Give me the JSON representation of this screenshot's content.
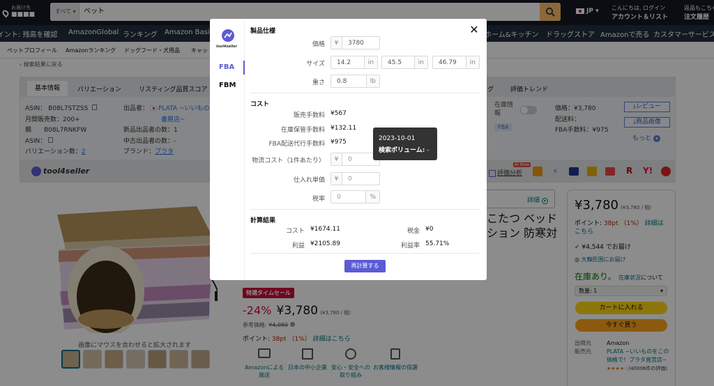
{
  "header": {
    "location_line1": "お届け先",
    "location_line2": "■■■■",
    "search_category": "すべて",
    "search_query": "ペット",
    "lang": "JP",
    "account_line1": "こんにちは, ログイン",
    "account_line2": "アカウント＆リスト",
    "orders_line1": "返品もこちら",
    "orders_line2": "注文履歴"
  },
  "nav": {
    "items": [
      "イント: 残高を確認",
      "AmazonGlobal",
      "ランキング",
      "Amazon Basics",
      "ホーム&キッチン",
      "ドラッグストア",
      "Amazonで売る",
      "カスタマーサービス"
    ]
  },
  "subnav": {
    "items": [
      "ペットプロフィール",
      "Amazonランキング",
      "ドッグフード・犬用品",
      "キャッ"
    ]
  },
  "breadcrumb": "‹ 検索結果に戻る",
  "ext_panel": {
    "tabs": [
      "基本情報",
      "バリエーション",
      "リスティング品質スコア",
      "グ",
      "評価トレンド"
    ],
    "asin_label": "ASIN：",
    "asin": "B08L7STZSS",
    "monthly_sales_label": "月間販売数：",
    "monthly_sales": "200+",
    "parent_label": "親",
    "parent_asin": "B08L7RNKFW",
    "asin2_label": "ASIN：",
    "variation_label": "バリエーション数：",
    "variation_count": "2",
    "seller_label": "出品者：",
    "seller": "PLATA ~いいもの",
    "seller2": "書屋店~",
    "new_sellers_label": "新品出品者の数：",
    "new_sellers": "1",
    "used_sellers_label": "中古出品者の数：",
    "used_sellers": "-",
    "brand_label": "ブランド：",
    "brand": "プラタ",
    "stock_label1": "在庫情",
    "stock_label2": "報",
    "fba_badge": "FBA",
    "price_label": "価格：",
    "price": "¥3,780",
    "shipping_label": "配送料：",
    "fba_fee_label": "FBA手数料：",
    "fba_fee": "¥975",
    "review_btn": "レビュー",
    "image_btn": "商品画像",
    "more": "もっと",
    "logo": "tool4seller",
    "price_analysis": "評価分析",
    "ai_new": "AI New"
  },
  "product": {
    "hover_hint": "画像にマウスを合わせると拡大されます",
    "title_line1": "こたつ ベッド",
    "title_line2": "ション 防寒対",
    "details_link": "詳細",
    "timesale_badge": "特選タイムセール",
    "discount": "-24%",
    "price": "¥3,780",
    "unit_price": "(¥3,780 / 個)",
    "ref_price_label": "参考価格:",
    "ref_price": "¥4,080",
    "points_label": "ポイント:",
    "points": "38pt （1%）",
    "points_link": "詳細はこちら",
    "features": [
      "Amazonによる発送",
      "日本の中小企業",
      "安心・安全への取り組み",
      "お客様情報の保護"
    ]
  },
  "buybox": {
    "price": "¥3,780",
    "unit": "(¥3,780 / 個)",
    "points_label": "ポイント:",
    "points": "38pt （1%）",
    "points_link": "詳細はこちら",
    "delivery": "¥4,544 でお届け",
    "location": "大韓民国にお届け",
    "in_stock": "在庫あり。",
    "stock_link": "在庫状況",
    "stock_suffix": "について",
    "qty": "数量: 1",
    "add_to_cart": "カートに入れる",
    "buy_now": "今すぐ買う",
    "ships_from_label": "出荷元",
    "ships_from": "Amazon",
    "sold_by_label": "販売元",
    "sold_by": "PLATA ~いいものをこの価格で！プラタ直営店~",
    "rating_count": "(40006件の評価)"
  },
  "modal": {
    "sidebar_tabs": [
      "FBA",
      "FBM"
    ],
    "logo": "tool4seller",
    "spec_title": "製品仕様",
    "price_label": "価格",
    "price_prefix": "¥",
    "price_value": "3780",
    "size_label": "サイズ",
    "size_values": [
      "14.2",
      "45.5",
      "46.79"
    ],
    "size_unit": "in",
    "weight_label": "重さ",
    "weight_value": "0.8",
    "weight_unit": "lb",
    "cost_title": "コスト",
    "sales_fee_label": "販売手数料",
    "sales_fee": "¥567",
    "storage_fee_label": "在庫保管手数料",
    "storage_fee": "¥132.11",
    "fba_fee_label": "FBA配送代行手数料",
    "fba_fee": "¥975",
    "logistics_label": "物流コスト（1件あたり）",
    "logistics_value": "0",
    "purchase_label": "仕入れ単価",
    "purchase_value": "0",
    "tax_label": "税率",
    "tax_value": "0",
    "tax_unit": "%",
    "result_title": "計算結果",
    "cost_label": "コスト",
    "cost_value": "¥1674.11",
    "tax_result_label": "税金",
    "tax_result_value": "¥0",
    "profit_label": "利益",
    "profit_value": "¥2105.89",
    "margin_label": "利益率",
    "margin_value": "55.71%",
    "recalc_button": "再計算する"
  },
  "tooltip": {
    "date": "2023-10-01",
    "label": "検索ボリューム:",
    "value": "-"
  },
  "colors": {
    "accent": "#5b5bd6",
    "amazon_orange": "#febd69",
    "deal_red": "#cc0c39"
  }
}
